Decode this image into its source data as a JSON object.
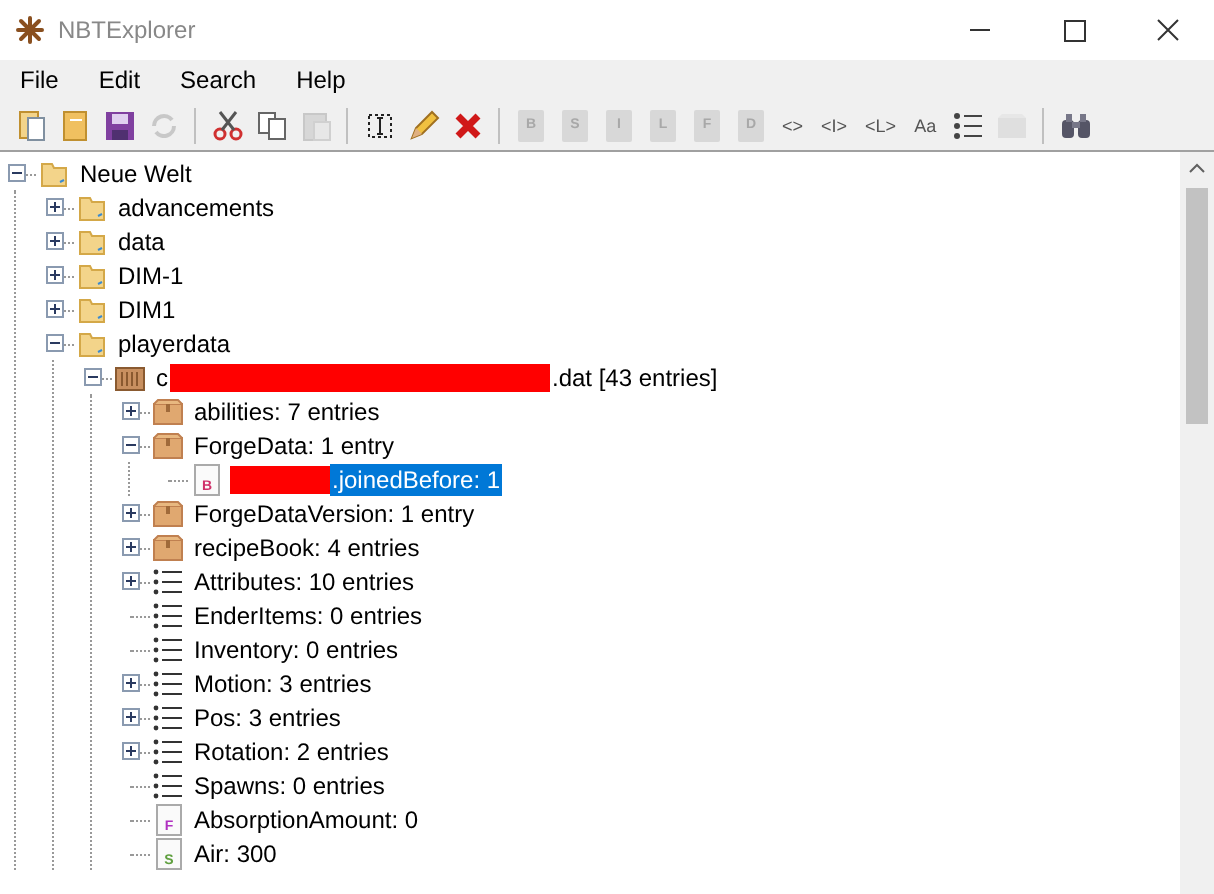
{
  "window": {
    "title": "NBTExplorer"
  },
  "menu": [
    {
      "label": "File"
    },
    {
      "label": "Edit"
    },
    {
      "label": "Search"
    },
    {
      "label": "Help"
    }
  ],
  "toolbar": [
    {
      "kind": "open-file",
      "disabled": false
    },
    {
      "kind": "open-folder",
      "disabled": false
    },
    {
      "kind": "save",
      "disabled": false
    },
    {
      "kind": "refresh",
      "disabled": true
    },
    {
      "kind": "separator"
    },
    {
      "kind": "cut",
      "disabled": false
    },
    {
      "kind": "copy",
      "disabled": false
    },
    {
      "kind": "paste",
      "disabled": true
    },
    {
      "kind": "separator"
    },
    {
      "kind": "rename",
      "disabled": false
    },
    {
      "kind": "edit",
      "disabled": false
    },
    {
      "kind": "delete",
      "disabled": false
    },
    {
      "kind": "separator"
    },
    {
      "kind": "tag",
      "label": "B",
      "disabled": true
    },
    {
      "kind": "tag",
      "label": "S",
      "disabled": true
    },
    {
      "kind": "tag",
      "label": "I",
      "disabled": true
    },
    {
      "kind": "tag",
      "label": "L",
      "disabled": true
    },
    {
      "kind": "tag",
      "label": "F",
      "disabled": true
    },
    {
      "kind": "tag",
      "label": "D",
      "disabled": true
    },
    {
      "kind": "brackets",
      "label": "<>",
      "disabled": false
    },
    {
      "kind": "brackets",
      "label": "<I>",
      "disabled": false
    },
    {
      "kind": "brackets",
      "label": "<L>",
      "disabled": false
    },
    {
      "kind": "text",
      "label": "Aa",
      "disabled": false
    },
    {
      "kind": "list",
      "disabled": false
    },
    {
      "kind": "compound",
      "disabled": true
    },
    {
      "kind": "separator"
    },
    {
      "kind": "find",
      "disabled": false
    }
  ],
  "tree": [
    {
      "kind": "folder",
      "label": "Neue Welt",
      "expanded": true,
      "selected": false,
      "children": [
        {
          "kind": "folder",
          "label": "advancements",
          "expanded": false,
          "selected": false
        },
        {
          "kind": "folder",
          "label": "data",
          "expanded": false,
          "selected": false
        },
        {
          "kind": "folder",
          "label": "DIM-1",
          "expanded": false,
          "selected": false
        },
        {
          "kind": "folder",
          "label": "DIM1",
          "expanded": false,
          "selected": false
        },
        {
          "kind": "folder",
          "label": "playerdata",
          "expanded": true,
          "selected": false,
          "children": [
            {
              "kind": "file",
              "prefix": "c",
              "redacted": true,
              "label": ".dat [43 entries]",
              "expanded": true,
              "selected": false,
              "children": [
                {
                  "kind": "compound",
                  "label": "abilities: 7 entries",
                  "expanded": false,
                  "selected": false
                },
                {
                  "kind": "compound",
                  "label": "ForgeData: 1 entry",
                  "expanded": true,
                  "selected": false,
                  "children": [
                    {
                      "kind": "byte",
                      "letter": "B",
                      "redacted": true,
                      "label": ".joinedBefore: 1",
                      "selected": true
                    }
                  ]
                },
                {
                  "kind": "compound",
                  "label": "ForgeDataVersion: 1 entry",
                  "expanded": false,
                  "selected": false
                },
                {
                  "kind": "compound",
                  "label": "recipeBook: 4 entries",
                  "expanded": false,
                  "selected": false
                },
                {
                  "kind": "list",
                  "label": "Attributes: 10 entries",
                  "expanded": false,
                  "selected": false
                },
                {
                  "kind": "list",
                  "label": "EnderItems: 0 entries",
                  "selected": false
                },
                {
                  "kind": "list",
                  "label": "Inventory: 0 entries",
                  "selected": false
                },
                {
                  "kind": "list",
                  "label": "Motion: 3 entries",
                  "expanded": false,
                  "selected": false
                },
                {
                  "kind": "list",
                  "label": "Pos: 3 entries",
                  "expanded": false,
                  "selected": false
                },
                {
                  "kind": "list",
                  "label": "Rotation: 2 entries",
                  "expanded": false,
                  "selected": false
                },
                {
                  "kind": "list",
                  "label": "Spawns: 0 entries",
                  "selected": false
                },
                {
                  "kind": "float",
                  "letter": "F",
                  "label": "AbsorptionAmount: 0",
                  "selected": false
                },
                {
                  "kind": "short",
                  "letter": "S",
                  "label": "Air: 300",
                  "selected": false
                }
              ]
            }
          ]
        }
      ]
    }
  ]
}
